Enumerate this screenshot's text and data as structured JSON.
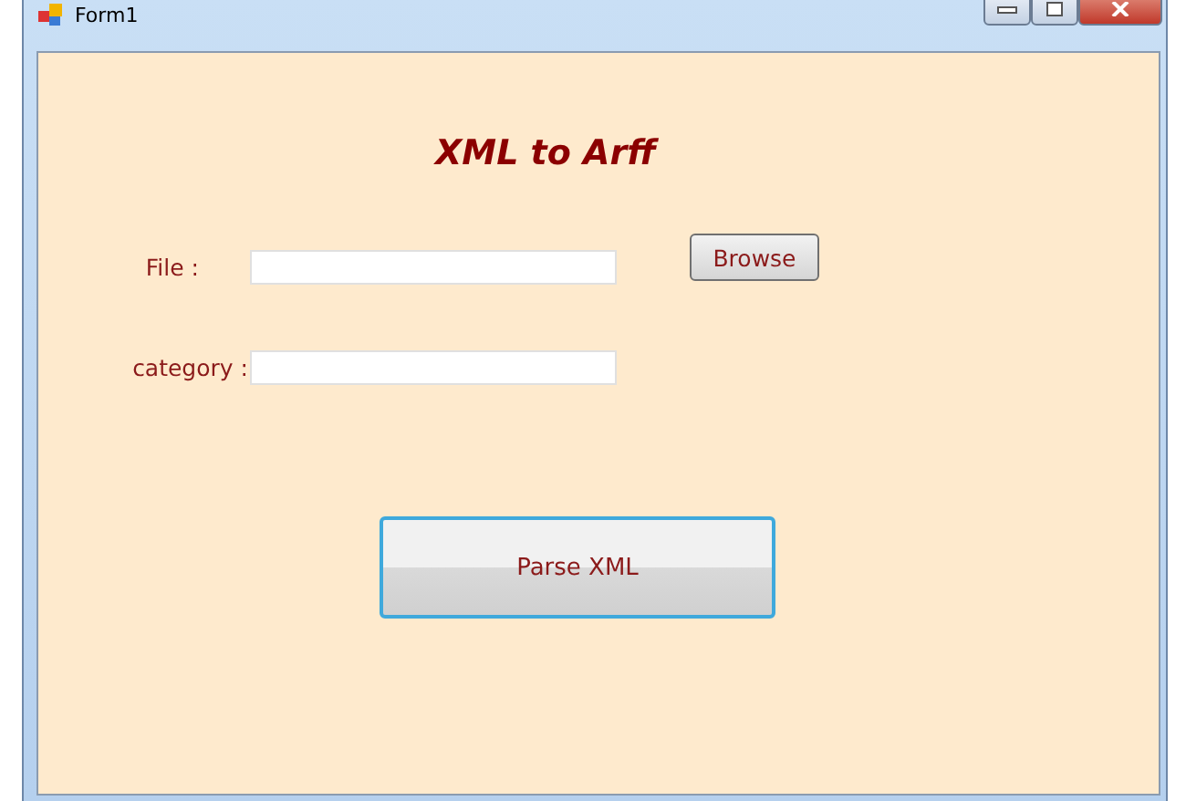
{
  "window": {
    "title": "Form1"
  },
  "heading": "XML to Arff",
  "fields": [
    {
      "label": "File :"
    },
    {
      "label": "category :"
    }
  ],
  "browse_button": "Browse",
  "parse_button": "Parse XML"
}
